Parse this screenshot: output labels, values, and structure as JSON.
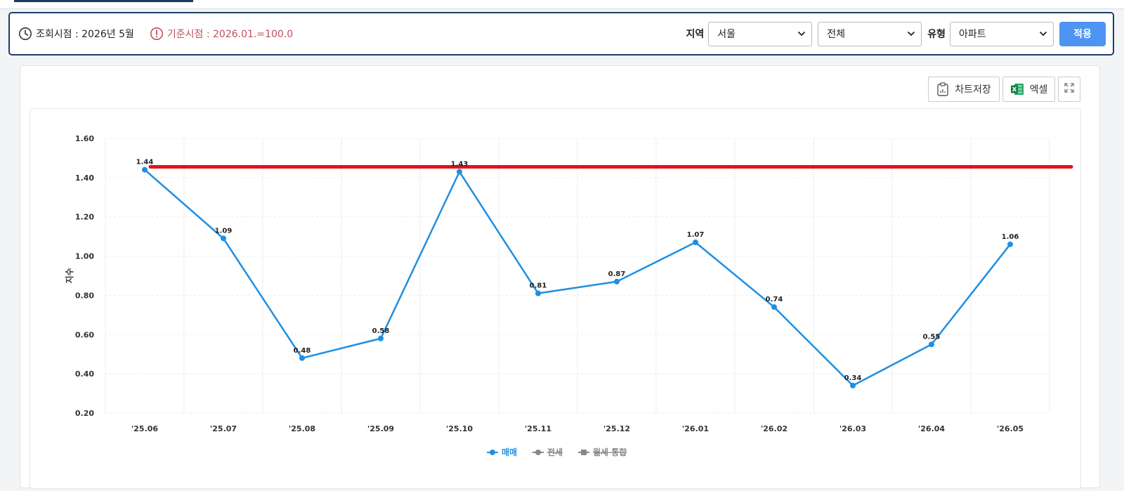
{
  "filters": {
    "as_of": "조회시점 : 2026년 5월",
    "base_point": "기준시점 : 2026.01.=100.0",
    "region_label": "지역",
    "region_value": "서울",
    "district_value": "전체",
    "type_label": "유형",
    "type_value": "아파트",
    "apply_label": "적용"
  },
  "toolbar": {
    "save_chart_label": "차트저장",
    "excel_label": "엑셀"
  },
  "chart_data": {
    "type": "line",
    "categories": [
      "'25.06",
      "'25.07",
      "'25.08",
      "'25.09",
      "'25.10",
      "'25.11",
      "'25.12",
      "'26.01",
      "'26.02",
      "'26.03",
      "'26.04",
      "'26.05"
    ],
    "series": [
      {
        "name": "매매",
        "color": "#1f8fe0",
        "visible": true,
        "values": [
          1.44,
          1.09,
          0.48,
          0.58,
          1.43,
          0.81,
          0.87,
          1.07,
          0.74,
          0.34,
          0.55,
          1.06
        ]
      },
      {
        "name": "전세",
        "color": "#777777",
        "visible": false,
        "values": []
      },
      {
        "name": "월세 통합",
        "color": "#666666",
        "visible": false,
        "values": []
      }
    ],
    "reference_line": {
      "value": 1.455,
      "color": "#e0141b"
    },
    "ylabel": "지수",
    "ylim": [
      0.2,
      1.6
    ],
    "yticks": [
      "1.60",
      "1.40",
      "1.20",
      "1.00",
      "0.80",
      "0.60",
      "0.40",
      "0.20"
    ],
    "grid": true,
    "legend": "bottom-center"
  }
}
